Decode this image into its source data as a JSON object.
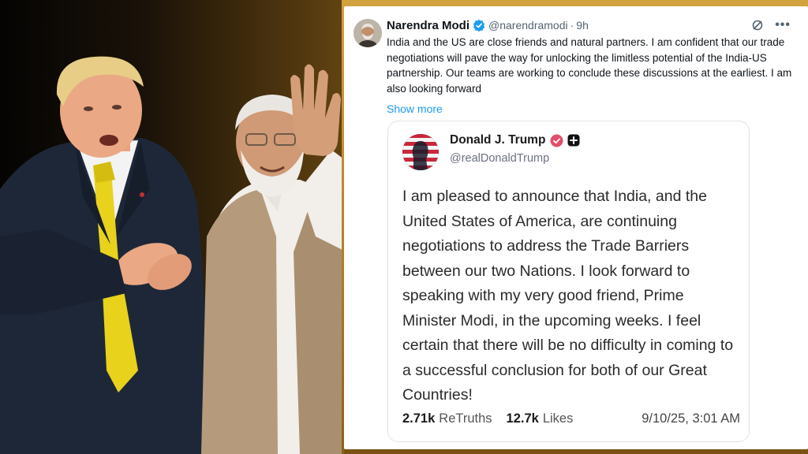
{
  "post": {
    "author_name": "Narendra Modi",
    "author_handle": "@narendramodi",
    "separator": "·",
    "time": "9h",
    "text": "India and the US are close friends and natural partners. I am confident that our trade negotiations will pave the way for unlocking the limitless potential of the India-US partnership. Our teams are working to conclude these discussions at the earliest. I am also looking forward",
    "show_more": "Show more",
    "more_icon": "•••"
  },
  "quoted": {
    "author_name": "Donald J. Trump",
    "author_handle": "@realDonaldTrump",
    "text": "I am pleased to announce that India, and the United States of America, are continuing negotiations to address the Trade Barriers between our two Nations. I look forward to speaking with my very good friend, Prime Minister Modi, in the upcoming weeks. I feel certain that there will be no difficulty in coming to a successful conclusion for both of our Great Countries!",
    "retruths_count": "2.71k",
    "retruths_label": "ReTruths",
    "likes_count": "12.7k",
    "likes_label": "Likes",
    "date": "9/10/25, 3:01 AM"
  },
  "colors": {
    "link": "#1d9bf0",
    "verified_blue": "#1d9bf0",
    "truth_verified": "#e0506a",
    "gold_background": "#c99a35"
  },
  "icons": [
    "verified-badge-icon",
    "grok-icon",
    "more-options-icon",
    "truth-verified-icon",
    "plus-badge-icon"
  ]
}
